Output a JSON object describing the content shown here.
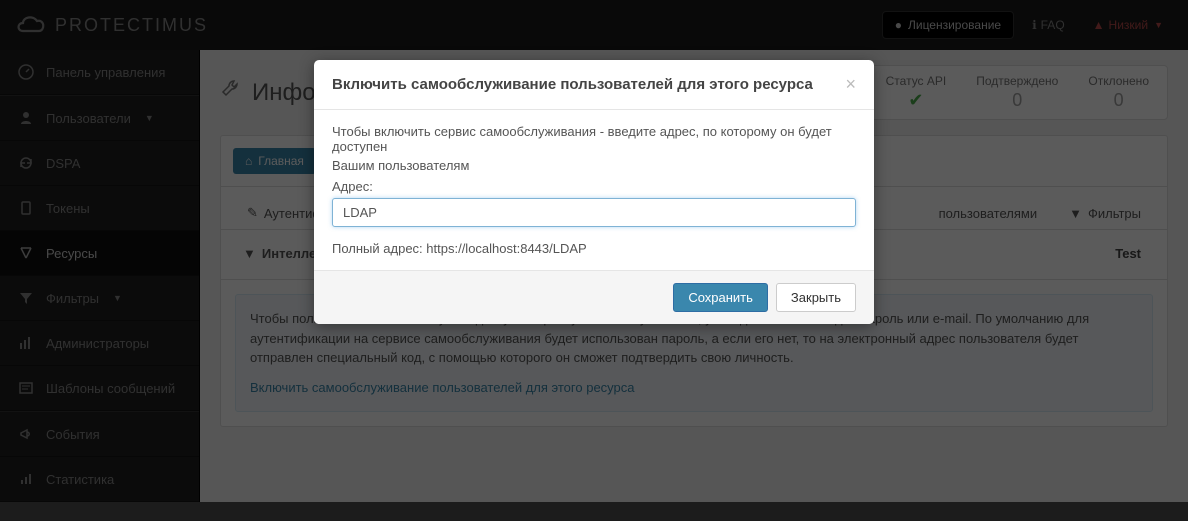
{
  "brand": "PROTECTIMUS",
  "topbar": {
    "licensing": "Лицензирование",
    "faq": "FAQ",
    "user": "Низкий"
  },
  "sidebar": {
    "dashboard": "Панель управления",
    "users": "Пользователи",
    "dspa": "DSPA",
    "tokens": "Токены",
    "resources": "Ресурсы",
    "filters": "Фильтры",
    "admins": "Администраторы",
    "templates": "Шаблоны сообщений",
    "events": "События",
    "statistics": "Статистика"
  },
  "page": {
    "title_prefix": "Инфо",
    "stats": {
      "api": {
        "label": "Статус API",
        "value": "✔"
      },
      "confirmed": {
        "label": "Подтверждено",
        "value": "0"
      },
      "denied": {
        "label": "Отклонено",
        "value": "0"
      }
    },
    "crumb_home": "Главная",
    "tabs": {
      "auth": "Аутентифик",
      "selfservice": "пользователями",
      "filters": "Фильтры",
      "intellect": "Интеллекту",
      "right": "Test"
    },
    "info": {
      "text": "Чтобы пользователи могли получить доступ к сервису самообслуживания, у них должен быть задан пароль или e-mail. По умолчанию для аутентификации на сервисе самообслуживания будет использован пароль, а если его нет, то на электронный адрес пользователя будет отправлен специальный код, с помощью которого он сможет подтвердить свою личность.",
      "link": "Включить самообслуживание пользователей для этого ресурса"
    }
  },
  "modal": {
    "title": "Включить самообслуживание пользователей для этого ресурса",
    "desc1": "Чтобы включить сервис самообслуживания - введите адрес, по которому он будет доступен",
    "desc2": "Вашим пользователям",
    "label": "Адрес:",
    "value": "LDAP",
    "full_prefix": "Полный адрес: ",
    "full_url": "https://localhost:8443/LDAP",
    "save": "Сохранить",
    "close": "Закрыть"
  }
}
